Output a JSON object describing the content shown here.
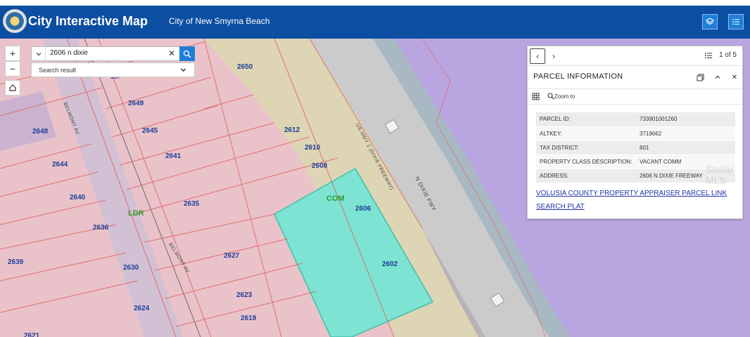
{
  "header": {
    "title": "City Interactive Map",
    "subtitle": "City of New Smyrna Beach",
    "buttons": [
      "layers-icon",
      "list-icon"
    ],
    "colors": {
      "bar": "#0c4ea2",
      "button": "#1e7fd8"
    }
  },
  "search": {
    "value": "2606 n dixie",
    "result_label": "Search result"
  },
  "map_controls": [
    "zoom-in",
    "zoom-out",
    "home"
  ],
  "map": {
    "parcels": [
      "2650",
      "167",
      "2649",
      "2645",
      "2648",
      "2641",
      "2644",
      "2640",
      "2636",
      "2635",
      "2639",
      "2630",
      "2627",
      "2624",
      "2623",
      "2619",
      "2621",
      "2612",
      "2610",
      "2608",
      "2606",
      "2602"
    ],
    "zones": [
      "LDR",
      "COM"
    ],
    "roads": [
      "BELMONT AV",
      "US HWY 1 (DIXIE FREEWAY)",
      "N DIXIE FWY",
      "BELMONT AV"
    ],
    "colors": {
      "highlight": "#7de3d2",
      "parcel_line": "#e06666",
      "zone_purple": "#b7a2dd"
    }
  },
  "popup": {
    "pager": "1 of 5",
    "title": "PARCEL INFORMATION",
    "zoom_label": "Zoom to",
    "attributes": [
      {
        "key": "PARCEL ID:",
        "value": "733901001260"
      },
      {
        "key": "ALTKEY:",
        "value": "3719662"
      },
      {
        "key": "TAX DISTRICT:",
        "value": "601"
      },
      {
        "key": "PROPERTY CLASS DESCRIPTION:",
        "value": "VACANT COMM"
      },
      {
        "key": "ADDRESS:",
        "value": "2606 N DIXIE FREEWAY"
      }
    ],
    "links": [
      "VOLUSIA COUNTY PROPERTY APPRAISER PARCEL LINK",
      "SEARCH PLAT"
    ]
  },
  "watermark": "Stellar MLS"
}
